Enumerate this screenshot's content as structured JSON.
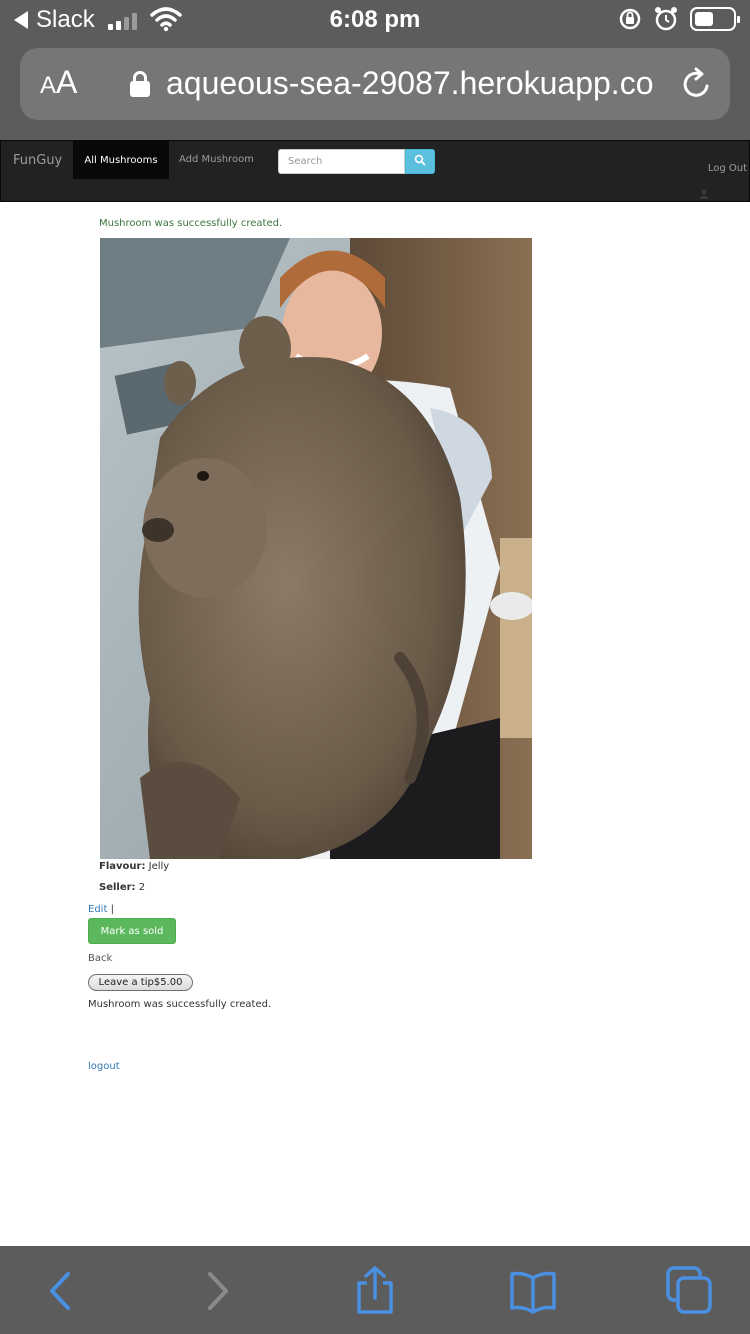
{
  "status_bar": {
    "back_app": "Slack",
    "time": "6:08 pm"
  },
  "url_bar": {
    "text_size_small": "A",
    "text_size_large": "A",
    "url": "aqueous-sea-29087.herokuapp.co"
  },
  "navbar": {
    "brand": "FunGuy",
    "active_item": "All Mushrooms",
    "item_add": "Add Mushroom",
    "search_placeholder": "Search",
    "logout": "Log Out"
  },
  "flash": {
    "success": "Mushroom was successfully created."
  },
  "mushroom": {
    "image_alt": "Woman holding a large wombat",
    "flavour_label": "Flavour:",
    "flavour_value": "Jelly",
    "seller_label": "Seller:",
    "seller_value": "2"
  },
  "actions": {
    "edit": "Edit",
    "separator": "|",
    "mark_sold": "Mark as sold",
    "back": "Back",
    "tip": "Leave a tip$5.00"
  },
  "notice": "Mushroom was successfully created.",
  "footer": {
    "logout": "logout"
  },
  "colors": {
    "navbar_bg": "#222222",
    "success_text": "#3c763d",
    "link": "#337ab7",
    "success_button": "#5cb85c",
    "search_button": "#5bc0de",
    "ios_chrome": "#5c5c5c",
    "ios_accent": "#4a90e2"
  },
  "icons": {
    "back": "chevron-left-icon",
    "forward": "chevron-right-icon",
    "share": "share-icon",
    "bookmarks": "book-icon",
    "tabs": "tabs-icon",
    "search": "search-icon",
    "reload": "reload-icon"
  }
}
